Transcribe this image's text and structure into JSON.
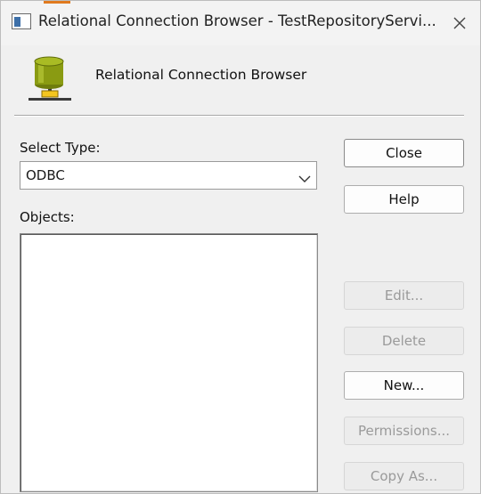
{
  "window": {
    "title": "Relational Connection Browser - TestRepositoryServi..."
  },
  "header": {
    "title": "Relational Connection Browser",
    "icon": "database-icon"
  },
  "form": {
    "select_type_label": "Select Type:",
    "select_type_value": "ODBC",
    "objects_label": "Objects:",
    "objects": []
  },
  "buttons": {
    "close": "Close",
    "help": "Help",
    "edit": "Edit...",
    "delete": "Delete",
    "new": "New...",
    "permissions": "Permissions...",
    "copy_as": "Copy As..."
  },
  "colors": {
    "window_bg": "#f0f0f0",
    "disabled_text": "#9a9a9a",
    "icon_body": "#8a9b12",
    "icon_accent": "#f3c51f"
  }
}
